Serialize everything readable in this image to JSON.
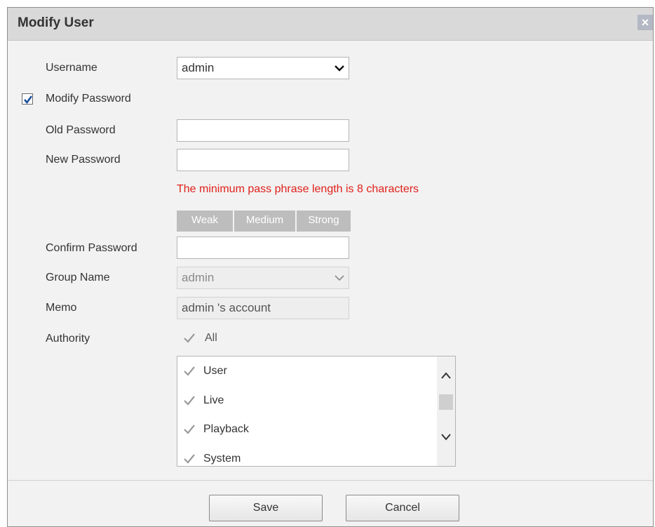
{
  "dialog": {
    "title": "Modify User",
    "close_icon": "close-icon"
  },
  "form": {
    "username_label": "Username",
    "username_value": "admin",
    "modify_password_label": "Modify Password",
    "modify_password_checked": true,
    "old_password_label": "Old Password",
    "old_password_value": "",
    "new_password_label": "New Password",
    "new_password_value": "",
    "password_hint": "The minimum pass phrase length is 8 characters",
    "strength_levels": [
      "Weak",
      "Medium",
      "Strong"
    ],
    "confirm_password_label": "Confirm Password",
    "confirm_password_value": "",
    "group_name_label": "Group Name",
    "group_name_value": "admin",
    "memo_label": "Memo",
    "memo_value": "admin 's account",
    "authority_label": "Authority",
    "authority_all_label": "All",
    "authority_items": [
      "User",
      "Live",
      "Playback",
      "System"
    ]
  },
  "buttons": {
    "save_label": "Save",
    "cancel_label": "Cancel"
  },
  "colors": {
    "warning": "#e0211b",
    "checkbox_check": "#1d4f9e",
    "disabled_check": "#9a9a9a"
  }
}
